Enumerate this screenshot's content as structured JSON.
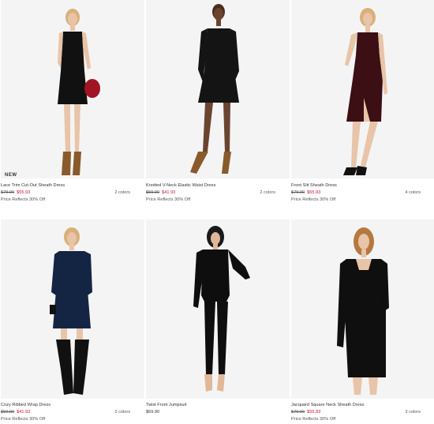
{
  "products": [
    {
      "badge": "NEW",
      "name": "Lace Trim Cut-Out Sheath Dress",
      "original_price": "$79.90",
      "sale_price": "$55.93",
      "promo": "Price Reflects 30% Off",
      "colors": "2 colors",
      "dress_color": "#111111"
    },
    {
      "badge": "",
      "name": "Knotted V-Neck Elastic Waist Dress",
      "original_price": "$59.90",
      "sale_price": "$41.93",
      "promo": "Price Reflects 30% Off",
      "colors": "2 colors",
      "dress_color": "#141414"
    },
    {
      "badge": "",
      "name": "Front Slit Sheath Dress",
      "original_price": "$79.90",
      "sale_price": "$55.93",
      "promo": "Price Reflects 30% Off",
      "colors": "4 colors",
      "dress_color": "#3b0f14"
    },
    {
      "badge": "",
      "name": "Cozy Ribbed Wrap Dress",
      "original_price": "$59.90",
      "sale_price": "$41.93",
      "promo": "Price Reflects 30% Off",
      "colors": "2 colors",
      "dress_color": "#142544"
    },
    {
      "badge": "",
      "name": "Twist Front Jumpsuit",
      "original_price": "",
      "sale_price": "",
      "regular_price": "$69.90",
      "promo": "",
      "colors": "",
      "dress_color": "#0e0e0e"
    },
    {
      "badge": "",
      "name": "Jacquard Square Neck Sheath Dress",
      "original_price": "$79.90",
      "sale_price": "$55.93",
      "promo": "Price Reflects 30% Off",
      "colors": "3 colors",
      "dress_color": "#0f0f0f"
    }
  ],
  "colors": {
    "sale": "#c8102e",
    "photo_background": "#f4f4f4",
    "skin": "#e8c4a8"
  }
}
